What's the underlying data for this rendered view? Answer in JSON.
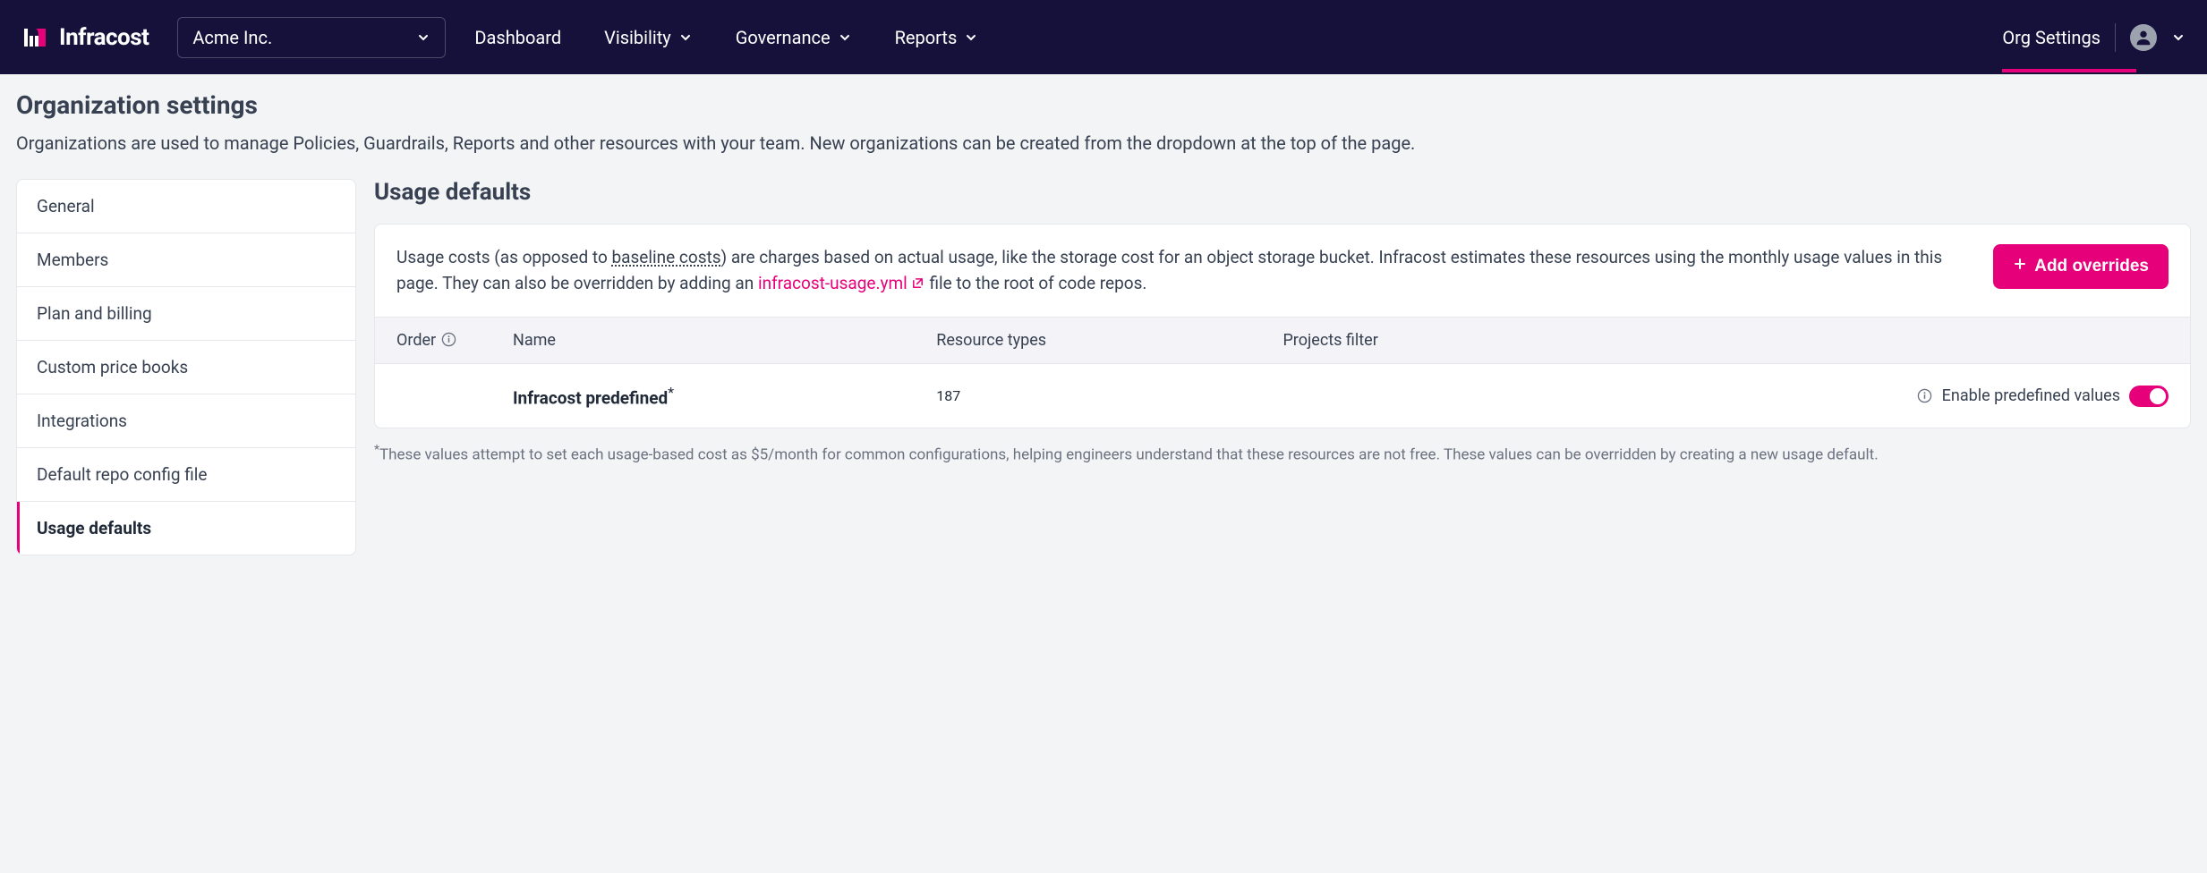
{
  "brand": "Infracost",
  "org_selector": {
    "value": "Acme Inc."
  },
  "nav": {
    "items": [
      "Dashboard",
      "Visibility",
      "Governance",
      "Reports"
    ],
    "org_settings": "Org Settings"
  },
  "page": {
    "title": "Organization settings",
    "subtitle": "Organizations are used to manage Policies, Guardrails, Reports and other resources with your team. New organizations can be created from the dropdown at the top of the page."
  },
  "sidebar": {
    "items": [
      {
        "label": "General"
      },
      {
        "label": "Members"
      },
      {
        "label": "Plan and billing"
      },
      {
        "label": "Custom price books"
      },
      {
        "label": "Integrations"
      },
      {
        "label": "Default repo config file"
      },
      {
        "label": "Usage defaults",
        "active": true
      }
    ]
  },
  "section": {
    "title": "Usage defaults",
    "desc_prefix": "Usage costs (as opposed to ",
    "desc_underline": "baseline costs",
    "desc_mid": ") are charges based on actual usage, like the storage cost for an object storage bucket. Infracost estimates these resources using the monthly usage values in this page. They can also be overridden by adding an ",
    "desc_link": "infracost-usage.yml",
    "desc_suffix": " file to the root of code repos.",
    "add_button": "Add overrides"
  },
  "table": {
    "headers": {
      "order": "Order",
      "name": "Name",
      "types": "Resource types",
      "filter": "Projects filter"
    },
    "rows": [
      {
        "name": "Infracost predefined",
        "name_sup": "*",
        "types": "187",
        "filter": "",
        "enable_label": "Enable predefined values",
        "toggle": true
      }
    ]
  },
  "footnote": "These values attempt to set each usage-based cost as $5/month for common configurations, helping engineers understand that these resources are not free. These values can be overridden by creating a new usage default.",
  "footnote_sup": "*"
}
